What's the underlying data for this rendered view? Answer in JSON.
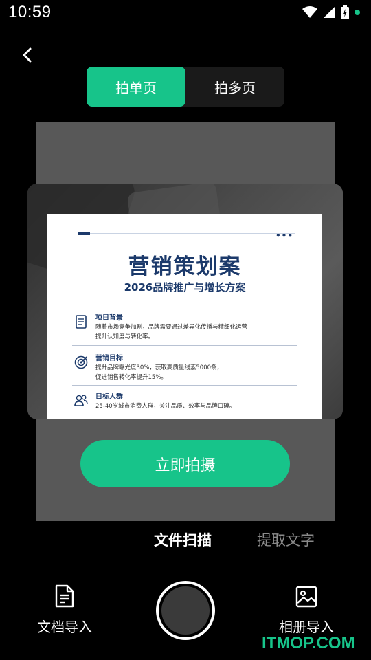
{
  "status_bar": {
    "time": "10:59",
    "dot_color": "#17c48a"
  },
  "header": {
    "back_icon": "chevron-left-icon"
  },
  "mode_toggle": {
    "options": [
      "拍单页",
      "拍多页"
    ],
    "active_index": 0,
    "accent_color": "#17c48a"
  },
  "preview": {
    "document": {
      "dots": "•••",
      "title": "营销策划案",
      "subtitle": "2026品牌推广与增长方案",
      "sections": [
        {
          "icon": "document-icon",
          "title": "项目背景",
          "body": [
            "随着市场竞争加剧，品牌需要通过差异化传播与精细化运营",
            "提升认知度与转化率。"
          ]
        },
        {
          "icon": "target-icon",
          "title": "营销目标",
          "body": [
            "提升品牌曝光度30%，获取高质量线索5000条，",
            "促进销售转化率提升15%。"
          ]
        },
        {
          "icon": "users-icon",
          "title": "目标人群",
          "body": [
            "25-40岁城市消费人群，关注品质、效率与品牌口碑。"
          ]
        }
      ]
    }
  },
  "capture_now_label": "立即拍摄",
  "tabs": {
    "scan": "文件扫描",
    "extract": "提取文字"
  },
  "toolbar": {
    "doc_import_label": "文档导入",
    "doc_import_icon": "file-text-icon",
    "album_import_label": "相册导入",
    "album_import_icon": "image-icon"
  },
  "watermark": "ITMOP.COM"
}
